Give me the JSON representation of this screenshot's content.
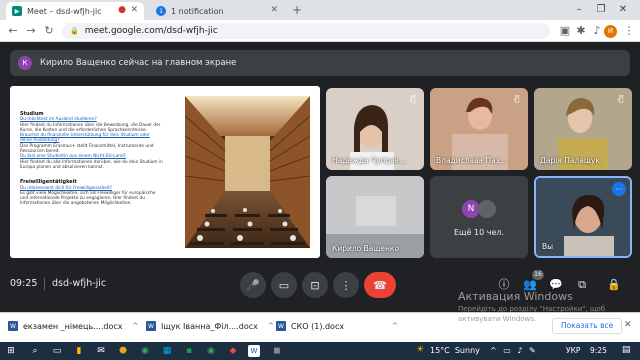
{
  "browser": {
    "tabs": [
      {
        "title": "Meet – dsd-wfjh-jic",
        "favicon": "meet-icon",
        "active": true
      },
      {
        "title": "1 notification",
        "favicon": "notification-icon",
        "active": false
      }
    ],
    "new_tab": "+",
    "url": "meet.google.com/dsd-wfjh-jic",
    "profile_initial": "И"
  },
  "meet": {
    "presenter_banner": {
      "initial": "К",
      "text": "Кирило Ващенко сейчас на главном экране"
    },
    "slide": {
      "heading1": "Studium",
      "lines1": [
        {
          "t": "Du möchtest im Ausland studieren?",
          "link": true
        },
        {
          "t": "Hier findest du Informationen über die Bewerbung, die Dauer der",
          "link": false
        },
        {
          "t": "Kurse, die Kosten und die erforderlichen Sprachkenntnisse.",
          "link": false
        },
        {
          "t": "Brauchst du finanzielle Unterstützung für dein Studium oder",
          "link": true
        },
        {
          "t": "deine Ausbildung?",
          "link": true
        },
        {
          "t": "Das Programm Erasmus+ stellt Finanzmittel, Instrumente und",
          "link": false
        },
        {
          "t": "Ressourcen bereit.",
          "link": false
        },
        {
          "t": "Du bist eine Studentin aus einem Nicht-EU-Land?",
          "link": true
        },
        {
          "t": "Hier findest du alle Informationen darüber, wie du dein Studium in",
          "link": false
        },
        {
          "t": "Europa planen und absolvieren kannst.",
          "link": false
        }
      ],
      "heading2": "Freiwilligentätigkeit",
      "lines2": [
        {
          "t": "Du interessierst dich für Freiwilligenarbeit?",
          "link": true
        },
        {
          "t": "Es gibt viele Möglichkeiten, sich als Freiwilliger für europäische",
          "link": false
        },
        {
          "t": "und internationale Projekte zu engagieren. Hier findest du",
          "link": false
        },
        {
          "t": "Informationen über die angebotenen Möglichkeiten.",
          "link": false
        }
      ]
    },
    "participants": [
      {
        "name": "Надежда Чупрак...",
        "muted": true,
        "bg": "#d9cfc7"
      },
      {
        "name": "Владислава Паз...",
        "muted": true,
        "bg": "#b88a6e"
      },
      {
        "name": "Дарія Палащук",
        "muted": true,
        "bg": "#9a8f77"
      },
      {
        "name": "Кирило Ващенко",
        "muted": false,
        "bg": "#b9babb"
      },
      {
        "name": "Ещё 10 чел.",
        "muted": false,
        "bg": "#3c4043",
        "more_initial": "N"
      },
      {
        "name": "Вы",
        "muted": false,
        "bg": "#2f3b48",
        "speaking": true
      }
    ],
    "meeting_info": {
      "time": "09:25",
      "code": "dsd-wfjh-jic"
    },
    "people_count": "16",
    "controls": [
      "mic-icon",
      "camera-icon",
      "present-icon",
      "more-vert-icon",
      "end-call-icon"
    ],
    "accent": "#ea4335"
  },
  "windows": {
    "activation_title": "Активация Windows",
    "activation_sub1": "Перейдіть до розділу \"Настройки\", щоб",
    "activation_sub2": "активувати Windows.",
    "downloads": [
      {
        "name": "екзамен _німець....docx"
      },
      {
        "name": "Іщук Іванна_Філ....docx"
      },
      {
        "name": "СКО (1).docx"
      }
    ],
    "show_all": "Показать все",
    "weather": "15°C  Sunny",
    "lang": "УКР",
    "clock": "9:25"
  }
}
